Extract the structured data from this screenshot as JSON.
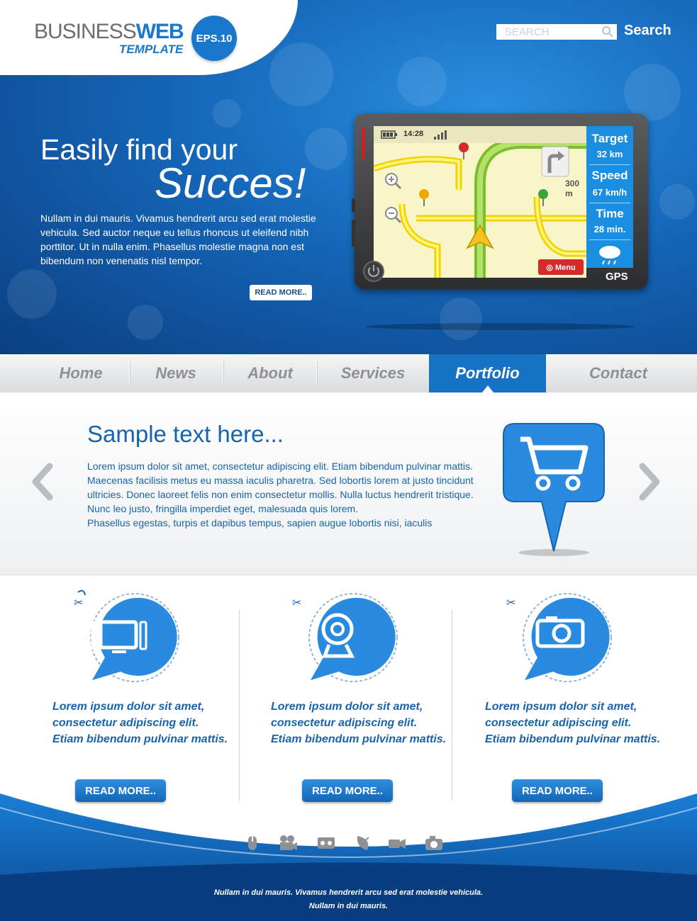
{
  "brand": {
    "name_part1": "BUSINESS",
    "name_part2": "WEB",
    "subtitle": "TEMPLATE",
    "badge": "EPS.10"
  },
  "search": {
    "placeholder": "SEARCH",
    "button_label": "Search"
  },
  "hero": {
    "line1": "Easily find your",
    "line2": "Succes!",
    "body": "Nullam in dui mauris. Vivamus hendrerit arcu sed erat molestie vehicula. Sed auctor neque eu tellus rhoncus ut eleifend nibh porttitor. Ut in nulla enim. Phasellus molestie magna non est bibendum non venenatis nisl tempor.",
    "read_more": "READ MORE.."
  },
  "gps": {
    "time": "14:28",
    "distance": "300 m",
    "target_label": "Target",
    "target_value": "32 km",
    "speed_label": "Speed",
    "speed_value": "67 km/h",
    "time_label": "Time",
    "time_value": "28 min.",
    "menu_label": "Menu",
    "device_label": "GPS",
    "icons": [
      "battery-icon",
      "signal-icon",
      "zoom-in-icon",
      "zoom-out-icon",
      "turn-right-icon",
      "map-pin-icon",
      "home-pin-icon",
      "weather-icon",
      "power-icon",
      "globe-icon"
    ]
  },
  "nav": {
    "items": [
      {
        "label": "Home"
      },
      {
        "label": "News"
      },
      {
        "label": "About"
      },
      {
        "label": "Services"
      },
      {
        "label": "Portfolio"
      },
      {
        "label": "Contact"
      }
    ],
    "active_index": 4
  },
  "slider": {
    "title": "Sample text here...",
    "body": "Lorem ipsum dolor sit amet, consectetur adipiscing elit. Etiam bibendum pulvinar mattis. Maecenas facilisis metus eu massa iaculis pharetra. Sed lobortis lorem at justo tincidunt ultricies. Donec laoreet felis non enim consectetur mollis. Nulla luctus hendrerit tristique. Nunc leo justo, fringilla imperdiet eget, malesuada quis lorem.",
    "body2": "Phasellus egestas, turpis et dapibus tempus, sapien augue lobortis nisi, iaculis",
    "prev_icon": "chevron-left-icon",
    "next_icon": "chevron-right-icon",
    "feature_icon": "shopping-cart-icon"
  },
  "features": [
    {
      "icon": "monitor-icon",
      "text": "Lorem ipsum dolor sit amet, consectetur adipiscing elit. Etiam bibendum pulvinar mattis.",
      "button": "READ MORE.."
    },
    {
      "icon": "webcam-icon",
      "text": "Lorem ipsum dolor sit amet, consectetur adipiscing elit. Etiam bibendum pulvinar mattis.",
      "button": "READ MORE.."
    },
    {
      "icon": "camera-icon",
      "text": "Lorem ipsum dolor sit amet, consectetur adipiscing elit. Etiam bibendum pulvinar mattis.",
      "button": "READ MORE.."
    }
  ],
  "footer": {
    "icons": [
      "mouse-icon",
      "film-camera-icon",
      "cassette-icon",
      "satellite-dish-icon",
      "camcorder-icon",
      "photo-camera-icon"
    ],
    "line1": "Nullam in dui mauris. Vivamus hendrerit arcu sed erat molestie vehicula.",
    "line2": "Nullam in dui mauris."
  },
  "colors": {
    "primary": "#1672c4",
    "dark_blue": "#0b3f82",
    "text_blue": "#1664ad",
    "nav_text": "#8d9196",
    "gps_red": "#d42a2a"
  }
}
